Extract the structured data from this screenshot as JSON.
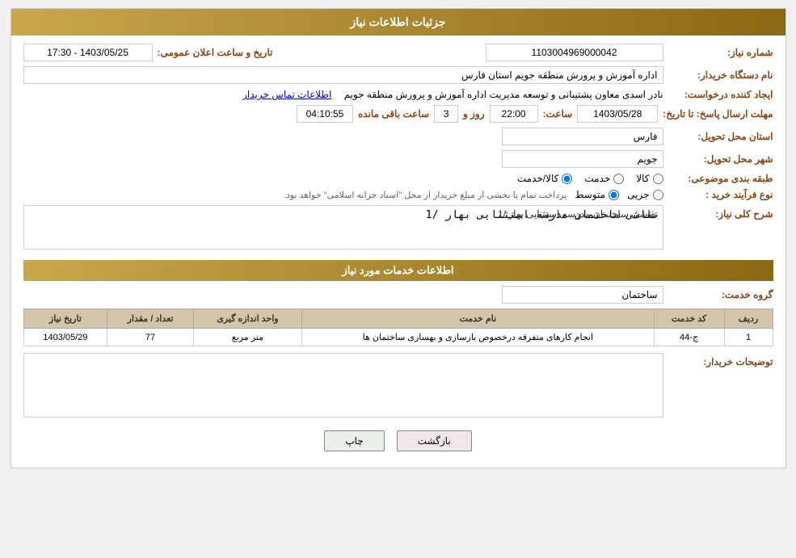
{
  "header": {
    "title": "جزئیات اطلاعات نیاز"
  },
  "fields": {
    "need_number_label": "شماره نیاز:",
    "need_number_value": "1103004969000042",
    "announce_date_label": "تاریخ و ساعت اعلان عمومی:",
    "announce_date_value": "1403/05/25 - 17:30",
    "buyer_org_label": "نام دستگاه خریدار:",
    "buyer_org_value": "اداره آموزش و پرورش منطقه جویم استان فارس",
    "creator_label": "ایجاد کننده درخواست:",
    "creator_value": "نادر اسدی معاون پشتیبانی و توسعه مدیریت اداره آموزش و پرورش منطقه جویم",
    "contact_link": "اطلاعات تماس خریدار",
    "deadline_label": "مهلت ارسال پاسخ: تا تاریخ:",
    "deadline_date": "1403/05/28",
    "deadline_time_label": "ساعت:",
    "deadline_time": "22:00",
    "deadline_day_label": "روز و",
    "deadline_days": "3",
    "deadline_remaining_label": "ساعت باقی مانده",
    "deadline_remaining": "04:10:55",
    "province_label": "استان محل تحویل:",
    "province_value": "فارس",
    "city_label": "شهر محل تحویل:",
    "city_value": "جویم",
    "category_label": "طبقه بندی موضوعی:",
    "category_option1": "کالا",
    "category_option2": "خدمت",
    "category_option3": "کالا/خدمت",
    "process_label": "نوع فرآیند خرید :",
    "process_option1": "جزیی",
    "process_option2": "متوسط",
    "process_note": "پرداخت تمام یا بخشی از مبلغ خریدار از محل \"اسناد خزانه اسلامی\" خواهد بود.",
    "description_label": "شرح کلی نیاز:",
    "description_value": "نقاشی ساختمان مدرسه استثنایی بهار /1",
    "services_header": "اطلاعات خدمات مورد نیاز",
    "service_group_label": "گروه خدمت:",
    "service_group_value": "ساختمان",
    "table": {
      "columns": [
        "ردیف",
        "کد خدمت",
        "نام خدمت",
        "واحد اندازه گیری",
        "تعداد / مقدار",
        "تاریخ نیاز"
      ],
      "rows": [
        {
          "row": "1",
          "code": "ج-44",
          "name": "انجام کارهای متفرقه درخصوص بازسازی و بهسازی ساختمان ها",
          "unit": "متر مربع",
          "qty": "77",
          "date": "1403/05/29"
        }
      ]
    },
    "buyer_notes_label": "توضیحات خریدار:",
    "buyer_notes_value": ""
  },
  "buttons": {
    "print": "چاپ",
    "back": "بازگشت"
  }
}
